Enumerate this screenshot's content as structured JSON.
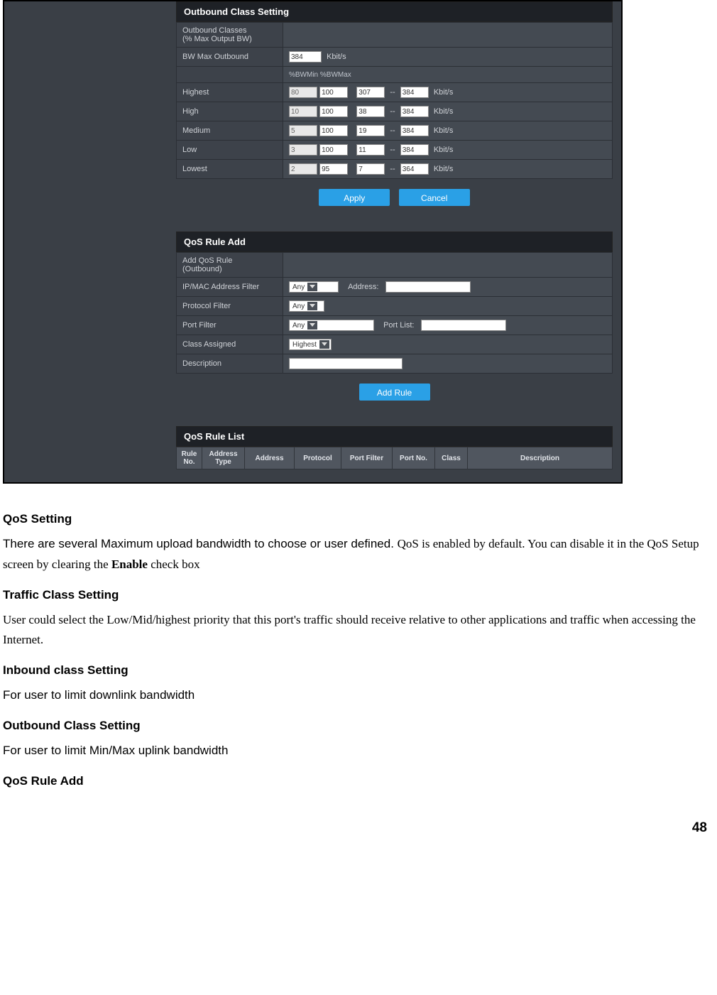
{
  "outbound": {
    "title": "Outbound Class Setting",
    "rows": {
      "classes_label": "Outbound Classes\n(% Max Output BW)",
      "bwmax_label": "BW Max Outbound",
      "bwmax_value": "384",
      "bwmax_unit": "Kbit/s",
      "subhdr": "%BWMin  %BWMax",
      "priorities": [
        {
          "name": "Highest",
          "min": "80",
          "max": "100",
          "calc_min": "307",
          "calc_max": "384",
          "unit": "Kbit/s"
        },
        {
          "name": "High",
          "min": "10",
          "max": "100",
          "calc_min": "38",
          "calc_max": "384",
          "unit": "Kbit/s"
        },
        {
          "name": "Medium",
          "min": "5",
          "max": "100",
          "calc_min": "19",
          "calc_max": "384",
          "unit": "Kbit/s"
        },
        {
          "name": "Low",
          "min": "3",
          "max": "100",
          "calc_min": "11",
          "calc_max": "384",
          "unit": "Kbit/s"
        },
        {
          "name": "Lowest",
          "min": "2",
          "max": "95",
          "calc_min": "7",
          "calc_max": "364",
          "unit": "Kbit/s"
        }
      ]
    },
    "buttons": {
      "apply": "Apply",
      "cancel": "Cancel"
    }
  },
  "ruleadd": {
    "title": "QoS Rule Add",
    "rows": {
      "addlabel": "Add QoS Rule\n(Outbound)",
      "ipmac_label": "IP/MAC Address Filter",
      "ipmac_select": "Any",
      "address_label": "Address:",
      "address_value": "",
      "protocol_label": "Protocol Filter",
      "protocol_select": "Any",
      "port_label": "Port Filter",
      "port_select": "Any",
      "portlist_label": "Port List:",
      "portlist_value": "",
      "class_label": "Class Assigned",
      "class_select": "Highest",
      "desc_label": "Description",
      "desc_value": ""
    },
    "button": "Add Rule"
  },
  "rulelist": {
    "title": "QoS Rule List",
    "headers": [
      "Rule\nNo.",
      "Address\nType",
      "Address",
      "Protocol",
      "Port Filter",
      "Port No.",
      "Class",
      "Description"
    ]
  },
  "doc": {
    "h1": "QoS Setting",
    "p1a": "There are several Maximum upload bandwidth to choose or user defined. ",
    "p1b": "QoS is enabled by default. You can disable it in the QoS Setup screen by clearing the ",
    "p1c": "Enable",
    "p1d": " check box",
    "h2": "Traffic Class Setting",
    "p2a": "User could ",
    "p2b": "select the Low/Mid/highest priority that this port's traffic should receive relative to other applications and traffic when accessing the Internet.",
    "h3": "Inbound class Setting",
    "p3": "For user to limit downlink bandwidth",
    "h4": "Outbound Class Setting",
    "p4": "For user to limit Min/Max uplink bandwidth",
    "h5": "QoS Rule Add",
    "page": "48"
  }
}
